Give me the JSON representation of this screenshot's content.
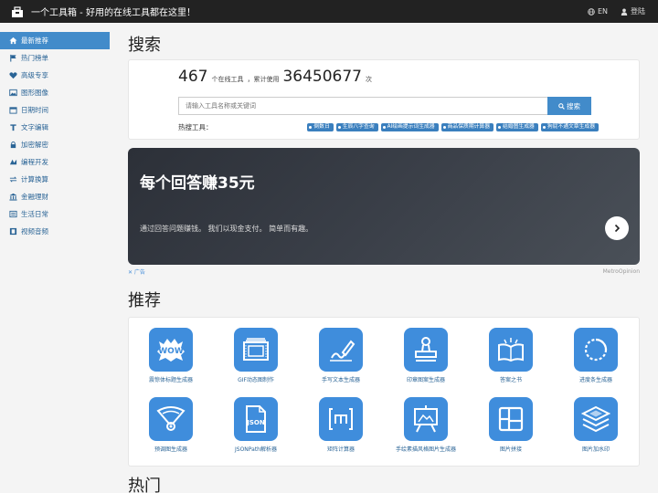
{
  "navbar": {
    "title": "一个工具箱 - 好用的在线工具都在这里！",
    "lang_label": "EN",
    "login_label": "登陆"
  },
  "sidebar": {
    "items": [
      {
        "label": "最新推荐",
        "icon": "home-icon",
        "active": true
      },
      {
        "label": "热门榜单",
        "icon": "flag-icon"
      },
      {
        "label": "高级专享",
        "icon": "heart-icon"
      },
      {
        "label": "图形图像",
        "icon": "image-icon"
      },
      {
        "label": "日期时间",
        "icon": "calendar-icon"
      },
      {
        "label": "文字编辑",
        "icon": "text-icon"
      },
      {
        "label": "加密解密",
        "icon": "lock-icon"
      },
      {
        "label": "编程开发",
        "icon": "code-icon"
      },
      {
        "label": "计算换算",
        "icon": "exchange-icon"
      },
      {
        "label": "金融理财",
        "icon": "bank-icon"
      },
      {
        "label": "生活日常",
        "icon": "list-icon"
      },
      {
        "label": "视频音频",
        "icon": "film-icon"
      }
    ]
  },
  "search_section": {
    "title": "搜索",
    "tool_count": "467",
    "tool_count_suffix": "个在线工具",
    "usage_prefix": "，累计使用",
    "usage_count": "36450677",
    "usage_suffix": "次",
    "placeholder": "请输入工具名称或关键词",
    "button_label": "搜索",
    "hot_label": "热搜工具：",
    "hot_tags": [
      "倒数日",
      "生辰八字查询",
      "AI绘画提示词生成器",
      "商品保质期计算器",
      "结婚图生成器",
      "狗屁不通文章生成器"
    ]
  },
  "ad": {
    "title": "每个回答赚35元",
    "subtitle": "通过回答问题赚钱。 我们以现金支付。 简单而有趣。",
    "adchoice": "✕ 广告",
    "brand": "MetroOpinion"
  },
  "recommend": {
    "title": "推荐",
    "tools": [
      {
        "label": "震惊体标题生成器",
        "icon": "wow-icon"
      },
      {
        "label": "GIF动态图制作",
        "icon": "film-frame-icon"
      },
      {
        "label": "手写文本生成器",
        "icon": "handwriting-icon"
      },
      {
        "label": "印章图案生成器",
        "icon": "stamp-icon"
      },
      {
        "label": "答案之书",
        "icon": "book-icon"
      },
      {
        "label": "进度条生成器",
        "icon": "progress-ring-icon"
      },
      {
        "label": "预调图生成器",
        "icon": "fan-icon"
      },
      {
        "label": "JSONPath解析器",
        "icon": "json-file-icon"
      },
      {
        "label": "矩阵计算器",
        "icon": "matrix-icon"
      },
      {
        "label": "手绘素描风格图片生成器",
        "icon": "easel-icon"
      },
      {
        "label": "图片拼接",
        "icon": "grid-icon"
      },
      {
        "label": "图片加水印",
        "icon": "layers-icon"
      }
    ]
  },
  "hot_section": {
    "title": "热门"
  }
}
